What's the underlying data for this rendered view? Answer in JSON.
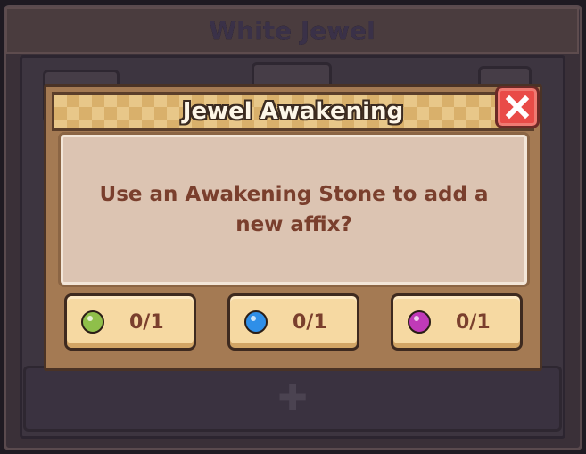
{
  "background": {
    "title": "White Jewel"
  },
  "dialog": {
    "title": "Jewel Awakening",
    "message": "Use an Awakening Stone to add a new affix?",
    "close_icon": "close-icon"
  },
  "stones": [
    {
      "icon": "green-stone-icon",
      "color": "#8fbf4a",
      "count": "0/1"
    },
    {
      "icon": "blue-stone-icon",
      "color": "#2f8fe8",
      "count": "0/1"
    },
    {
      "icon": "purple-stone-icon",
      "color": "#c03ab8",
      "count": "0/1"
    }
  ],
  "colors": {
    "header_bg": "#e8c789",
    "close_button": "#e94b47",
    "message_text": "#7a3f2d",
    "button_bg": "#f6d9a2"
  }
}
